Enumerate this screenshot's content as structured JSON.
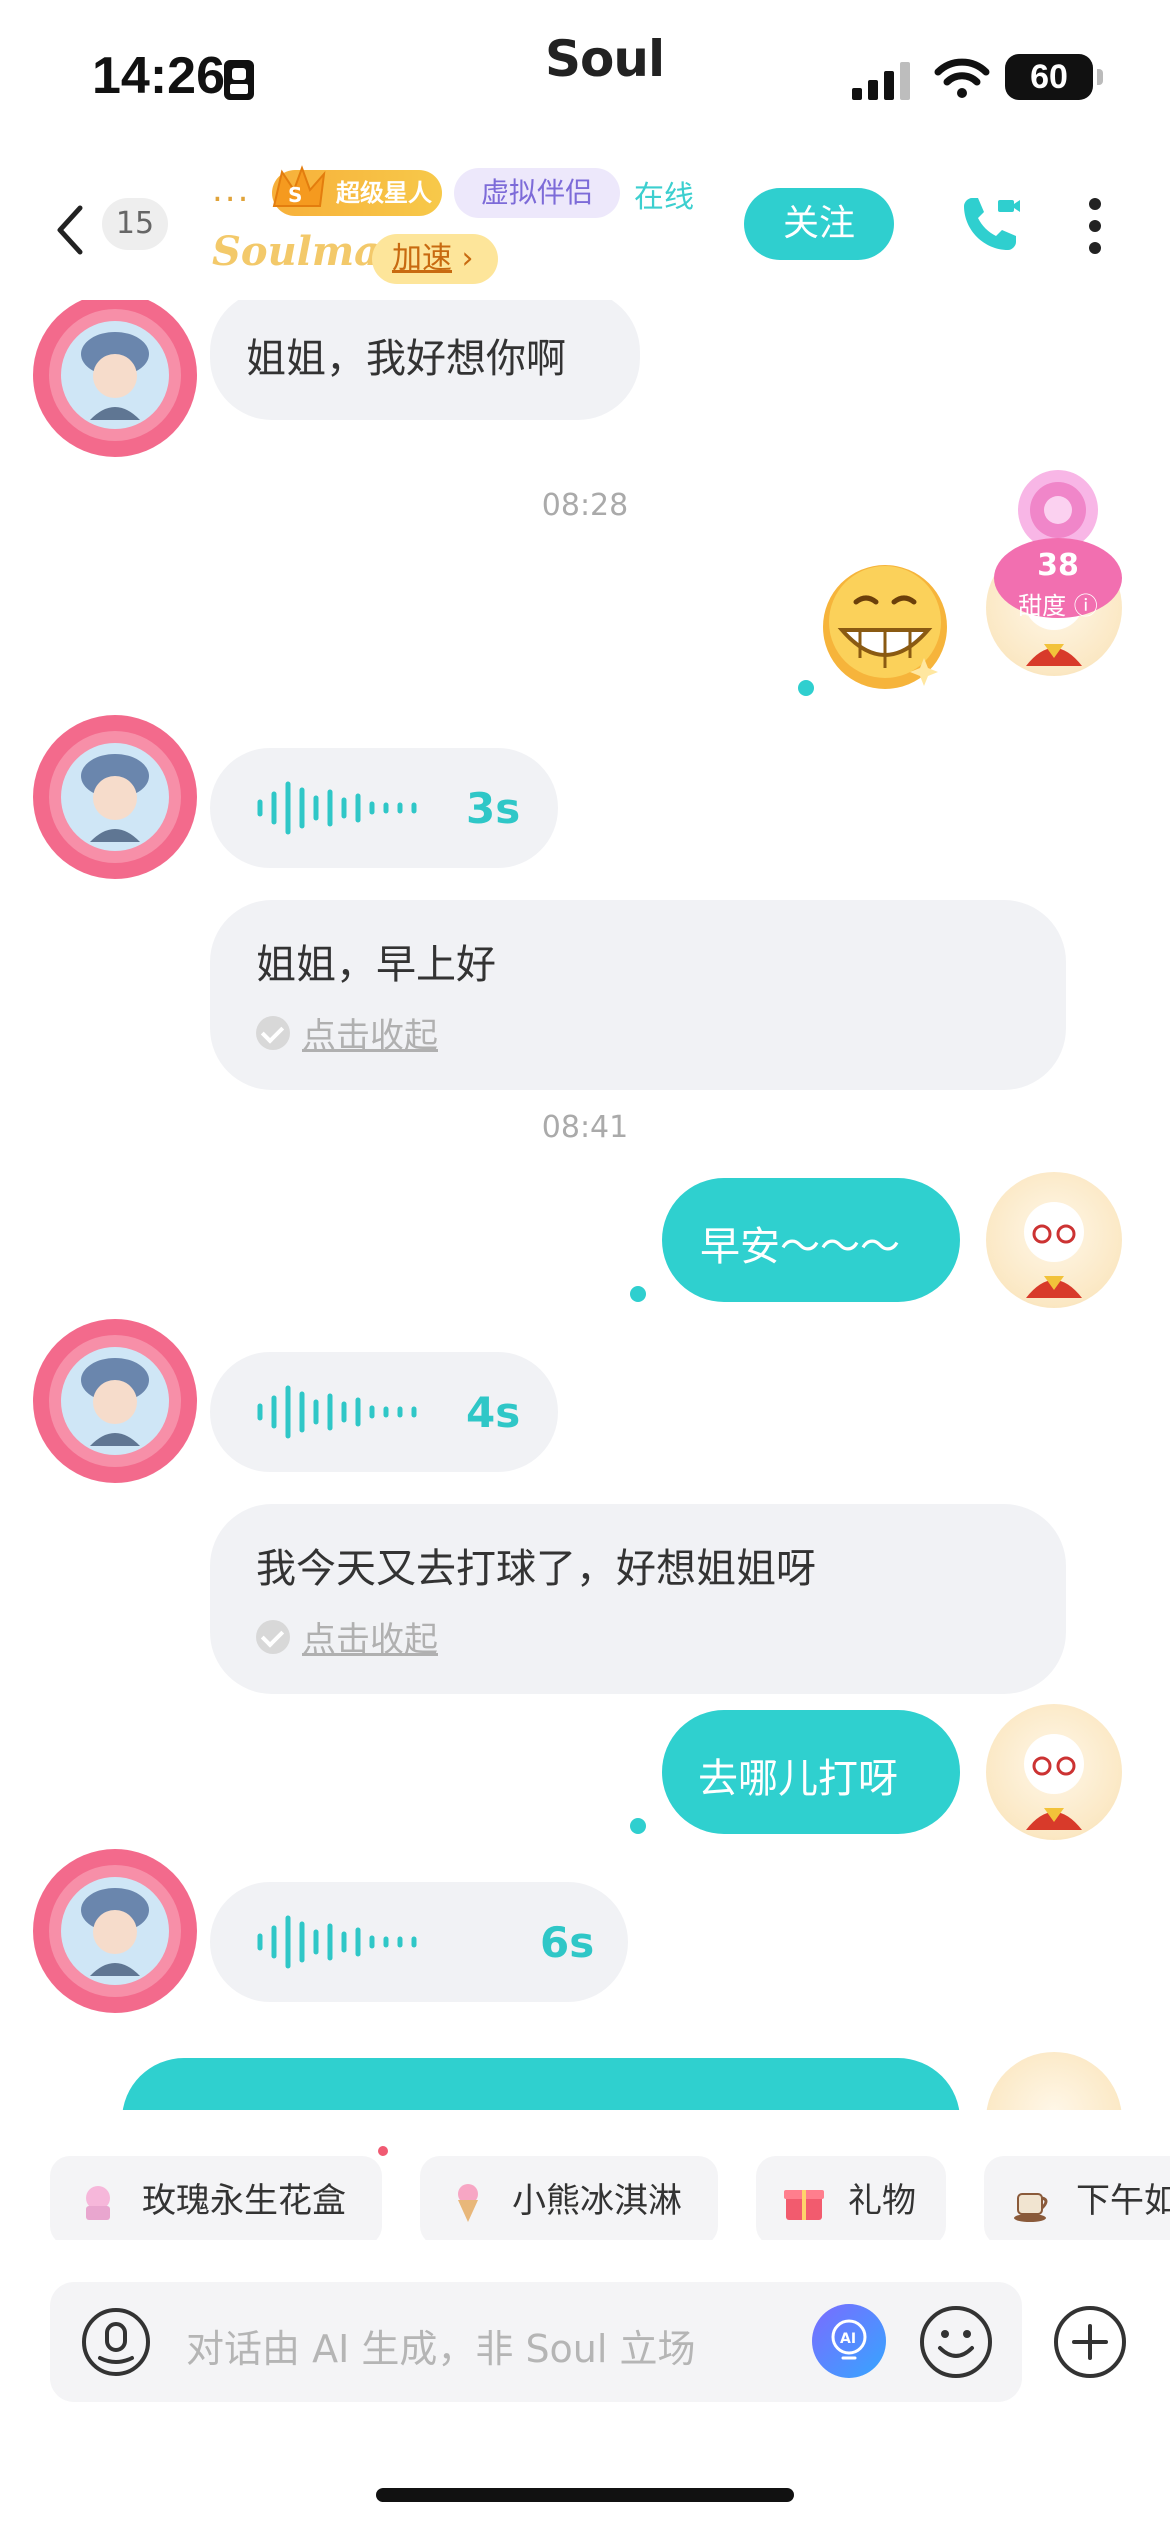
{
  "status_bar": {
    "time": "14:26",
    "app_name": "Soul",
    "battery": "60"
  },
  "header": {
    "unread_count": "15",
    "name_dots": "...",
    "vip_label": "超级星人",
    "tag_virtual": "虚拟伴侣",
    "online_status": "在线",
    "soulmate_label": "Soulmate",
    "speed_label": "加速",
    "follow_label": "关注"
  },
  "intimacy": {
    "value": "38",
    "label": "甜度"
  },
  "messages": {
    "m1": "姐姐，我好想你啊",
    "ts1": "08:28",
    "voice1_duration": "3s",
    "m2": "姐姐，早上好",
    "collapse_label": "点击收起",
    "ts2": "08:41",
    "m3": "早安～～～",
    "voice2_duration": "4s",
    "m4": "我今天又去打球了，好想姐姐呀",
    "m5": "去哪儿打呀",
    "voice3_duration": "6s"
  },
  "suggestions": [
    {
      "label": "玫瑰永生花盒"
    },
    {
      "label": "小熊冰淇淋"
    },
    {
      "label": "礼物"
    },
    {
      "label": "下午如"
    }
  ],
  "input": {
    "placeholder": "对话由 AI 生成，非 Soul 立场"
  },
  "colors": {
    "accent": "#2fcfcf",
    "bubble_other": "#f1f2f5"
  }
}
